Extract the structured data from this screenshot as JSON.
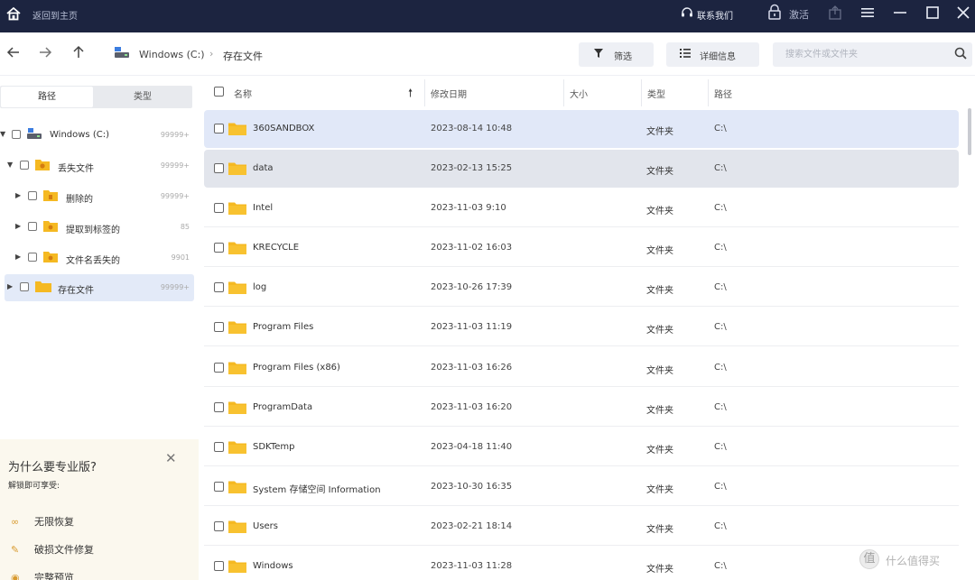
{
  "titlebar": {
    "home_label": "返回到主页",
    "contact": "联系我们",
    "activate": "激活"
  },
  "toolbar": {
    "drive": "Windows (C:)",
    "separator": "›",
    "current": "存在文件",
    "filter_label": "筛选",
    "detail_label": "详细信息",
    "search_placeholder": "搜索文件或文件夹"
  },
  "sidebar": {
    "tab_path": "路径",
    "tab_type": "类型",
    "tree": [
      {
        "label": "Windows (C:)",
        "count": "99999+"
      },
      {
        "label": "丢失文件",
        "count": "99999+"
      },
      {
        "label": "删除的",
        "count": "99999+"
      },
      {
        "label": "提取到标签的",
        "count": "85"
      },
      {
        "label": "文件名丢失的",
        "count": "9901"
      },
      {
        "label": "存在文件",
        "count": "99999+"
      }
    ],
    "promo": {
      "title": "为什么要专业版?",
      "subtitle": "解锁即可享受:",
      "items": [
        "无限恢复",
        "破损文件修复",
        "完整预览"
      ]
    }
  },
  "list": {
    "headers": {
      "name": "名称",
      "date": "修改日期",
      "size": "大小",
      "type": "类型",
      "path": "路径"
    },
    "rows": [
      {
        "name": "360SANDBOX",
        "date": "2023-08-14 10:48",
        "type": "文件夹",
        "path": "C:\\"
      },
      {
        "name": "data",
        "date": "2023-02-13 15:25",
        "type": "文件夹",
        "path": "C:\\"
      },
      {
        "name": "Intel",
        "date": "2023-11-03 9:10",
        "type": "文件夹",
        "path": "C:\\"
      },
      {
        "name": "KRECYCLE",
        "date": "2023-11-02 16:03",
        "type": "文件夹",
        "path": "C:\\"
      },
      {
        "name": "log",
        "date": "2023-10-26 17:39",
        "type": "文件夹",
        "path": "C:\\"
      },
      {
        "name": "Program Files",
        "date": "2023-11-03 11:19",
        "type": "文件夹",
        "path": "C:\\"
      },
      {
        "name": "Program Files (x86)",
        "date": "2023-11-03 16:26",
        "type": "文件夹",
        "path": "C:\\"
      },
      {
        "name": "ProgramData",
        "date": "2023-11-03 16:20",
        "type": "文件夹",
        "path": "C:\\"
      },
      {
        "name": "SDKTemp",
        "date": "2023-04-18 11:40",
        "type": "文件夹",
        "path": "C:\\"
      },
      {
        "name": "System 存储空间 Information",
        "date": "2023-10-30 16:35",
        "type": "文件夹",
        "path": "C:\\"
      },
      {
        "name": "Users",
        "date": "2023-02-21 18:14",
        "type": "文件夹",
        "path": "C:\\"
      },
      {
        "name": "Windows",
        "date": "2023-11-03 11:28",
        "type": "文件夹",
        "path": "C:\\"
      }
    ]
  },
  "watermark": {
    "icon_text": "值",
    "text": "什么值得买"
  },
  "colors": {
    "titlebar": "#1c2440",
    "folder": "#f5b922",
    "selected_row": "#e1e8f8",
    "promo_bg": "#fbf8ee"
  }
}
